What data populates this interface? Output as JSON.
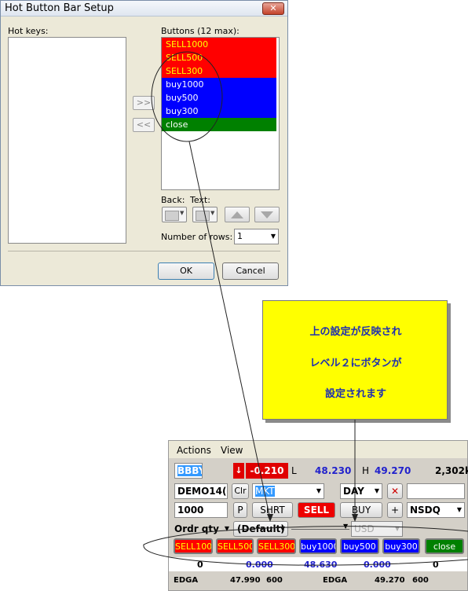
{
  "dialog": {
    "title": "Hot Button Bar Setup",
    "close_glyph": "✕",
    "hotkeys_label": "Hot keys:",
    "buttons_label": "Buttons (12 max):",
    "buttons": [
      {
        "label": "SELL1000",
        "bg": "#ff0000",
        "fg": "#ffff00"
      },
      {
        "label": "SELL500",
        "bg": "#ff0000",
        "fg": "#ffff00"
      },
      {
        "label": "SELL300",
        "bg": "#ff0000",
        "fg": "#ffff00"
      },
      {
        "label": "buy1000",
        "bg": "#0000ff",
        "fg": "#ffffff"
      },
      {
        "label": "buy500",
        "bg": "#0000ff",
        "fg": "#ffffff"
      },
      {
        "label": "buy300",
        "bg": "#0000ff",
        "fg": "#ffffff"
      },
      {
        "label": "close",
        "bg": "#008000",
        "fg": "#ffffff"
      }
    ],
    "add_label": ">>",
    "remove_label": "<<",
    "back_label": "Back:",
    "text_label": "Text:",
    "rows_label": "Number of rows:",
    "rows_value": "1",
    "ok_label": "OK",
    "cancel_label": "Cancel"
  },
  "callout": {
    "line1": "上の設定が反映され",
    "line2": "レベル２にボタンが",
    "line3": "設定されます",
    "bg": "#ffff00",
    "text_color": "#1f2fb0"
  },
  "level2": {
    "menu": {
      "actions": "Actions",
      "view": "View"
    },
    "symbol": "BBBY",
    "change": "-0.210",
    "low_label": "L",
    "low_value": "48.230",
    "high_label": "H",
    "high_value": "49.270",
    "volume": "2,302k",
    "account": "DEMO14(",
    "clr_label": "Clr",
    "order_type": "MKT",
    "tif": "DAY",
    "qty": "1000",
    "p_label": "P",
    "shrt_label": "SHRT",
    "sell_label": "SELL",
    "buy_label": "BUY",
    "plus_label": "+",
    "route": "NSDQ",
    "ordr_qty": "Ordr qty",
    "default_label": "(Default)",
    "currency": "USD",
    "hot_buttons": [
      {
        "label": "SELL1000",
        "bg": "#ff0000",
        "fg": "#ffff00"
      },
      {
        "label": "SELL500",
        "bg": "#ff0000",
        "fg": "#ffff00"
      },
      {
        "label": "SELL300",
        "bg": "#ff0000",
        "fg": "#ffff00"
      },
      {
        "label": "buy1000",
        "bg": "#0000ff",
        "fg": "#ffffff"
      },
      {
        "label": "buy500",
        "bg": "#0000ff",
        "fg": "#ffffff"
      },
      {
        "label": "buy300",
        "bg": "#0000ff",
        "fg": "#ffffff"
      },
      {
        "label": "close",
        "bg": "#008000",
        "fg": "#ffffff"
      }
    ],
    "stats": [
      "0",
      "0.000",
      "48.630",
      "0.000",
      "0"
    ],
    "book_bid": {
      "exchange": "EDGA",
      "price": "47.990",
      "size": "600"
    },
    "book_ask": {
      "exchange": "EDGA",
      "price": "49.270",
      "size": "600"
    }
  }
}
